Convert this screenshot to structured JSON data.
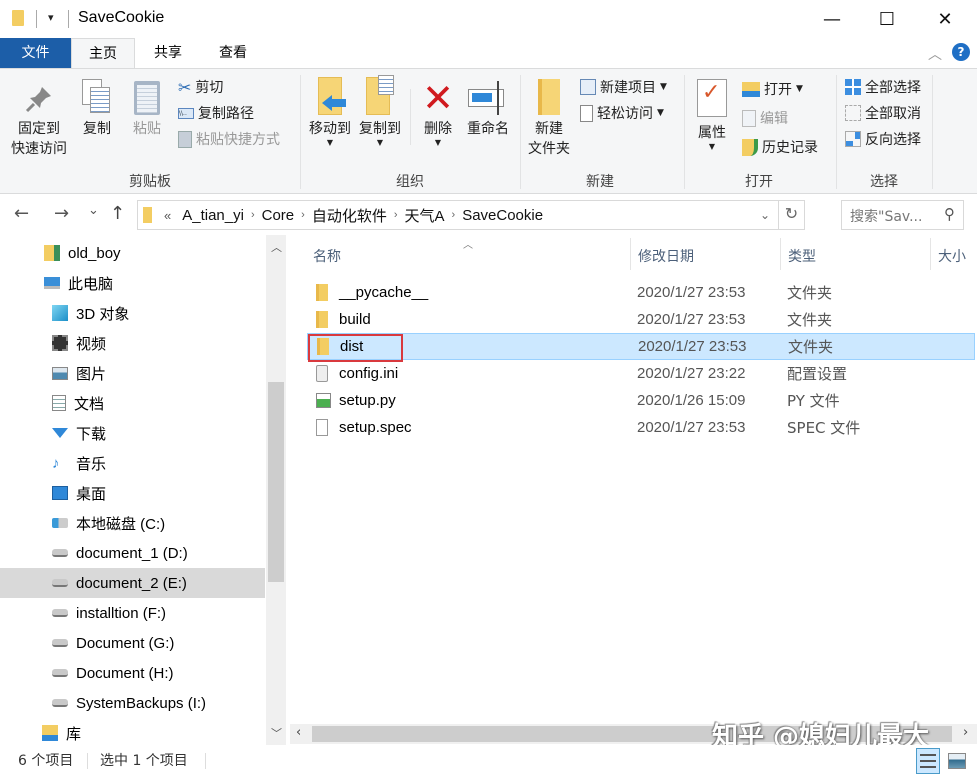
{
  "window": {
    "title": "SaveCookie",
    "minimize": "—",
    "maximize": "☐",
    "close": "✕"
  },
  "tabs": [
    {
      "label": "文件"
    },
    {
      "label": "主页"
    },
    {
      "label": "共享"
    },
    {
      "label": "查看"
    }
  ],
  "ribbon": {
    "clipboard": {
      "group_label": "剪贴板",
      "pin_line1": "固定到",
      "pin_line2": "快速访问",
      "copy": "复制",
      "paste": "粘贴",
      "cut": "剪切",
      "copy_path": "复制路径",
      "paste_shortcut": "粘贴快捷方式"
    },
    "organize": {
      "group_label": "组织",
      "move_to": "移动到",
      "copy_to": "复制到",
      "delete": "删除",
      "rename": "重命名"
    },
    "new": {
      "group_label": "新建",
      "new_folder_line1": "新建",
      "new_folder_line2": "文件夹",
      "new_item": "新建项目",
      "easy_access": "轻松访问"
    },
    "open": {
      "group_label": "打开",
      "properties": "属性",
      "open": "打开",
      "edit": "编辑",
      "history": "历史记录"
    },
    "select": {
      "group_label": "选择",
      "select_all": "全部选择",
      "select_none": "全部取消",
      "invert": "反向选择"
    }
  },
  "nav": {
    "back": "←",
    "forward": "→",
    "recent": "⌄",
    "up": "↑",
    "overflow": "«",
    "breadcrumbs": [
      "A_tian_yi",
      "Core",
      "自动化软件",
      "天气A",
      "SaveCookie"
    ],
    "refresh": "↻",
    "search_placeholder": "搜索\"Sav...",
    "search_icon": "⚲"
  },
  "sidebar": {
    "items": [
      {
        "label": "old_boy",
        "icon": "user-folder"
      },
      {
        "label": "此电脑",
        "icon": "computer"
      },
      {
        "label": "3D 对象",
        "icon": "3d-objects"
      },
      {
        "label": "视频",
        "icon": "video"
      },
      {
        "label": "图片",
        "icon": "pictures"
      },
      {
        "label": "文档",
        "icon": "documents"
      },
      {
        "label": "下载",
        "icon": "download"
      },
      {
        "label": "音乐",
        "icon": "music"
      },
      {
        "label": "桌面",
        "icon": "desktop"
      },
      {
        "label": "本地磁盘 (C:)",
        "icon": "system-drive"
      },
      {
        "label": "document_1 (D:)",
        "icon": "drive"
      },
      {
        "label": "document_2 (E:)",
        "icon": "drive"
      },
      {
        "label": "installtion (F:)",
        "icon": "drive"
      },
      {
        "label": "Document (G:)",
        "icon": "drive"
      },
      {
        "label": "Document (H:)",
        "icon": "drive"
      },
      {
        "label": "SystemBackups (I:)",
        "icon": "drive"
      },
      {
        "label": "库",
        "icon": "library"
      }
    ],
    "selected_index": 11
  },
  "columns": {
    "name": "名称",
    "date": "修改日期",
    "type": "类型",
    "size": "大小"
  },
  "files": [
    {
      "name": "__pycache__",
      "date": "2020/1/27 23:53",
      "type": "文件夹",
      "icon": "folder"
    },
    {
      "name": "build",
      "date": "2020/1/27 23:53",
      "type": "文件夹",
      "icon": "folder"
    },
    {
      "name": "dist",
      "date": "2020/1/27 23:53",
      "type": "文件夹",
      "icon": "folder",
      "selected": true
    },
    {
      "name": "config.ini",
      "date": "2020/1/27 23:22",
      "type": "配置设置",
      "icon": "ini"
    },
    {
      "name": "setup.py",
      "date": "2020/1/26 15:09",
      "type": "PY 文件",
      "icon": "python"
    },
    {
      "name": "setup.spec",
      "date": "2020/1/27 23:53",
      "type": "SPEC 文件",
      "icon": "file"
    }
  ],
  "status": {
    "item_count": "6 个项目",
    "selected": "选中 1 个项目"
  },
  "watermark": "知乎 @媳妇儿最大",
  "colors": {
    "file_tab": "#1c5ea8",
    "selection": "#cce8ff",
    "highlight_box": "#d9393e"
  }
}
